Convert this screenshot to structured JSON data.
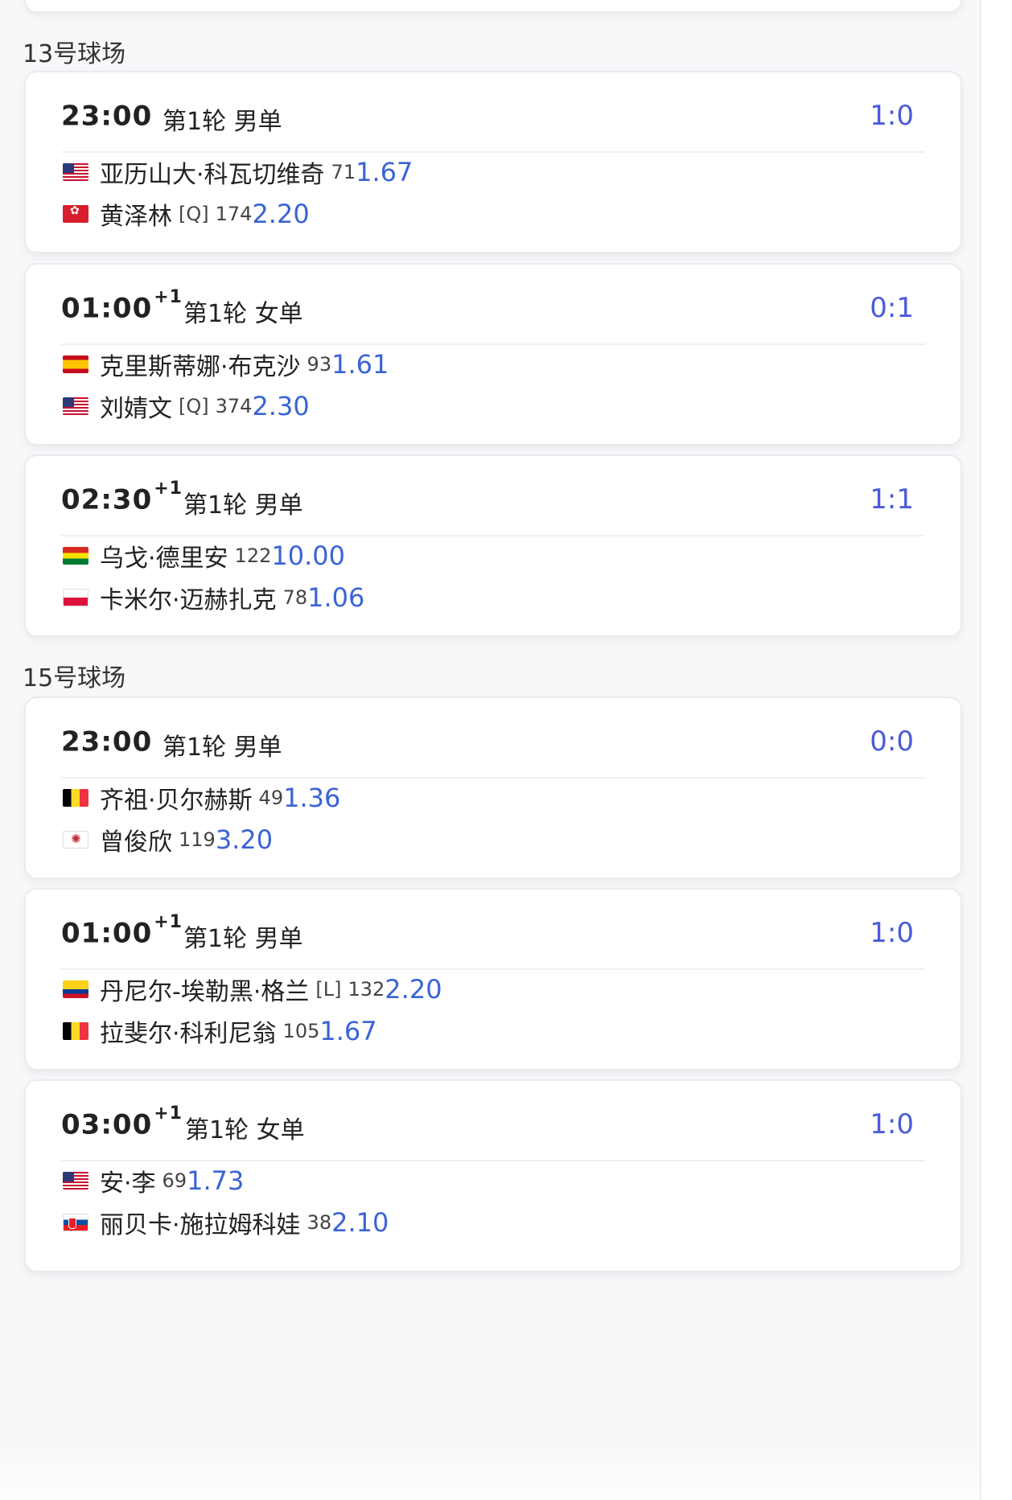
{
  "sections": [
    {
      "court": "13号球场",
      "matches": [
        {
          "time": "23:00",
          "plus": "",
          "round": "第1轮",
          "event": "男单",
          "score": "1:0",
          "players": [
            {
              "flag": "usa-flag-icon",
              "name": "亚历山大·科瓦切维奇",
              "seed": "",
              "rank": "71",
              "odds": "1.67"
            },
            {
              "flag": "hong-kong-flag-icon",
              "name": "黄泽林",
              "seed": "[Q]",
              "rank": "174",
              "odds": "2.20"
            }
          ]
        },
        {
          "time": "01:00",
          "plus": "+1",
          "round": "第1轮",
          "event": "女单",
          "score": "0:1",
          "players": [
            {
              "flag": "spain-flag-icon",
              "name": "克里斯蒂娜·布克沙",
              "seed": "",
              "rank": "93",
              "odds": "1.61"
            },
            {
              "flag": "usa-flag-icon",
              "name": "刘婧文",
              "seed": "[Q]",
              "rank": "374",
              "odds": "2.30"
            }
          ]
        },
        {
          "time": "02:30",
          "plus": "+1",
          "round": "第1轮",
          "event": "男单",
          "score": "1:1",
          "players": [
            {
              "flag": "bolivia-flag-icon",
              "name": "乌戈·德里安",
              "seed": "",
              "rank": "122",
              "odds": "10.00"
            },
            {
              "flag": "poland-flag-icon",
              "name": "卡米尔·迈赫扎克",
              "seed": "",
              "rank": "78",
              "odds": "1.06"
            }
          ]
        }
      ]
    },
    {
      "court": "15号球场",
      "matches": [
        {
          "time": "23:00",
          "plus": "",
          "round": "第1轮",
          "event": "男单",
          "score": "0:0",
          "players": [
            {
              "flag": "belgium-flag-icon",
              "name": "齐祖·贝尔赫斯",
              "seed": "",
              "rank": "49",
              "odds": "1.36"
            },
            {
              "flag": "chinese-taipei-flag-icon",
              "name": "曾俊欣",
              "seed": "",
              "rank": "119",
              "odds": "3.20"
            }
          ]
        },
        {
          "time": "01:00",
          "plus": "+1",
          "round": "第1轮",
          "event": "男单",
          "score": "1:0",
          "players": [
            {
              "flag": "colombia-flag-icon",
              "name": "丹尼尔-埃勒黑·格兰",
              "seed": "[L]",
              "rank": "132",
              "odds": "2.20"
            },
            {
              "flag": "belgium-flag-icon",
              "name": "拉斐尔·科利尼翁",
              "seed": "",
              "rank": "105",
              "odds": "1.67"
            }
          ]
        },
        {
          "time": "03:00",
          "plus": "+1",
          "round": "第1轮",
          "event": "女单",
          "score": "1:0",
          "players": [
            {
              "flag": "usa-flag-icon",
              "name": "安·李",
              "seed": "",
              "rank": "69",
              "odds": "1.73"
            },
            {
              "flag": "slovakia-flag-icon",
              "name": "丽贝卡·施拉姆科娃",
              "seed": "",
              "rank": "38",
              "odds": "2.10"
            }
          ]
        }
      ]
    }
  ],
  "colors": {
    "score": "#4a5bd8",
    "odds": "#3a63d6"
  }
}
